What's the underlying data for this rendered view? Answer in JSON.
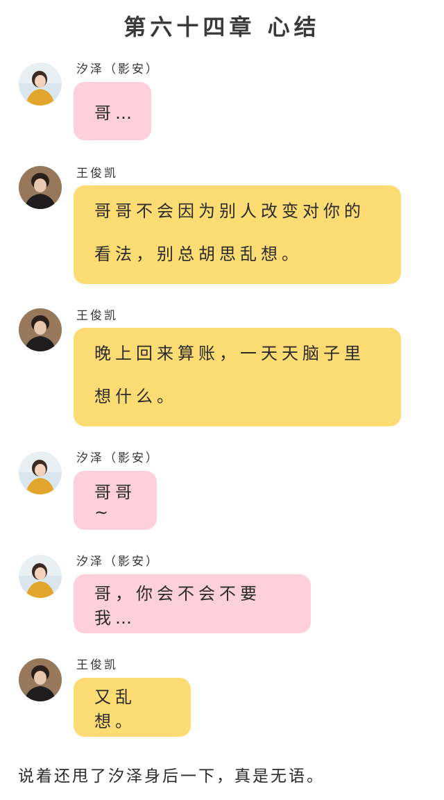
{
  "title": "第六十四章 心结",
  "messages": [
    {
      "sender": "汐泽（影安）",
      "role": "xize",
      "text": "哥…"
    },
    {
      "sender": "王俊凯",
      "role": "wjk",
      "text": "哥哥不会因为别人改变对你的看法，别总胡思乱想。"
    },
    {
      "sender": "王俊凯",
      "role": "wjk",
      "text": "晚上回来算账，一天天脑子里想什么。"
    },
    {
      "sender": "汐泽（影安）",
      "role": "xize",
      "text": "哥哥~"
    },
    {
      "sender": "汐泽（影安）",
      "role": "xize",
      "text": "哥，你会不会不要我…"
    },
    {
      "sender": "王俊凯",
      "role": "wjk",
      "text": "又乱想。"
    }
  ],
  "footer": "说着还甩了汐泽身后一下，真是无语。",
  "colors": {
    "pink_bubble": "#fdd0dc",
    "yellow_bubble": "#fddc73"
  }
}
